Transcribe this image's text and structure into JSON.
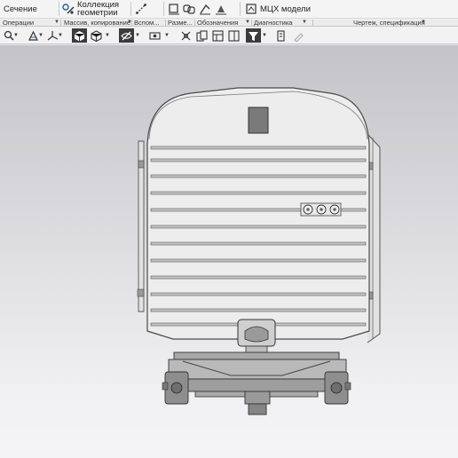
{
  "ribbon": {
    "section_label": "Сечение",
    "collection_label_line1": "Коллекция",
    "collection_label_line2": "геометрии",
    "mcx_label": "МЦХ модели",
    "icons": [
      "section-icon",
      "collection-geometry-icon",
      "measure-icon",
      "dimension-icon",
      "link-icon",
      "designation-icon",
      "weld-icon",
      "mcx-icon"
    ]
  },
  "groups": {
    "operations": "Операции",
    "mass_copy": "Массив, копирование",
    "auxiliary": "Вспом...",
    "dimensions": "Разме...",
    "designations": "Обозначения",
    "diagnostics": "Диагностика",
    "drawing_spec": "Чертеж, спецификация"
  },
  "toolbar": {
    "icons": [
      "zoom-icon",
      "orient-icon",
      "axis-icon",
      "display-mode-icon",
      "shaded-icon",
      "hide-icon",
      "visibility-icon",
      "grid-icon",
      "copy-icon",
      "panel-icon",
      "filter-icon",
      "measure-tool-icon",
      "edit-icon"
    ],
    "active": [
      "display-mode-icon",
      "hide-icon",
      "filter-icon"
    ]
  },
  "colors": {
    "ribbon_bg": "#f4f4f4",
    "active_button": "#3b3b3b",
    "viewport_top": "#c4c4c8",
    "viewport_bottom": "#f4f4f6",
    "model_fill": "#ececec",
    "model_line": "#555555"
  }
}
